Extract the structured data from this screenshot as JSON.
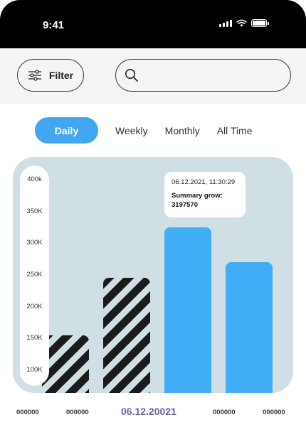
{
  "status": {
    "time": "9:41"
  },
  "toolbar": {
    "filter_label": "Filter",
    "search_placeholder": ""
  },
  "tabs": [
    {
      "label": "Daily",
      "active": true
    },
    {
      "label": "Weekly",
      "active": false
    },
    {
      "label": "Monthly",
      "active": false
    },
    {
      "label": "All Time",
      "active": false
    }
  ],
  "chart_data": {
    "type": "bar",
    "y_ticks": [
      "400k",
      "350K",
      "300K",
      "250K",
      "200K",
      "150K",
      "100K"
    ],
    "ylim": [
      50000,
      400000
    ],
    "categories": [
      "000000",
      "000000",
      "06.12.20021",
      "000000",
      "000000"
    ],
    "values": [
      155000,
      245000,
      325000,
      270000
    ],
    "selected_index": 2,
    "tooltip": {
      "date": "06.12.2021, 11:30:29",
      "label": "Summary grow:",
      "value": "3197570"
    }
  },
  "colors": {
    "accent": "#42a6f0",
    "bar_solid": "#42adf7",
    "bar_striped": "#1b1b1b",
    "chart_bg": "#d0dfe4",
    "date_highlight": "#6a63a8"
  }
}
